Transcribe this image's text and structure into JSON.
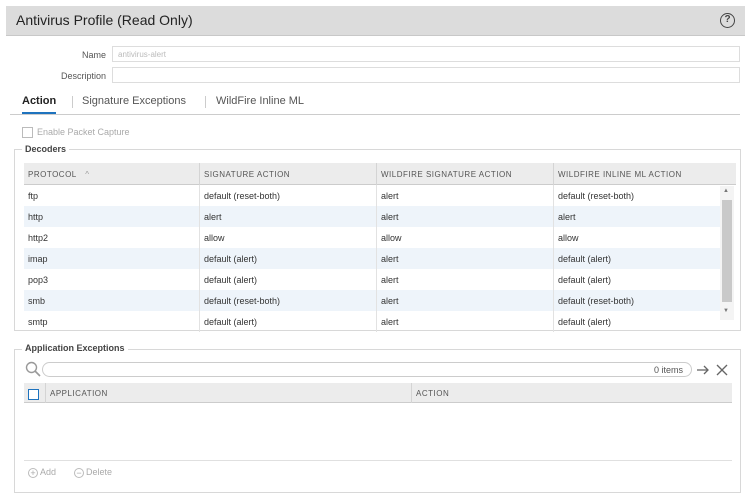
{
  "dialog": {
    "title": "Antivirus Profile (Read Only)",
    "help_symbol": "?"
  },
  "form": {
    "name_label": "Name",
    "name_value": "antivirus-alert",
    "description_label": "Description",
    "description_value": ""
  },
  "tabs": [
    {
      "label": "Action",
      "active": true
    },
    {
      "label": "Signature Exceptions",
      "active": false
    },
    {
      "label": "WildFire Inline ML",
      "active": false
    }
  ],
  "packet_capture": {
    "label": "Enable Packet Capture",
    "checked": false
  },
  "decoders": {
    "title": "Decoders",
    "columns": [
      "PROTOCOL",
      "SIGNATURE ACTION",
      "WILDFIRE SIGNATURE ACTION",
      "WILDFIRE INLINE ML ACTION"
    ],
    "sort_indicator": "^",
    "rows": [
      [
        "ftp",
        "default (reset-both)",
        "alert",
        "default (reset-both)"
      ],
      [
        "http",
        "alert",
        "alert",
        "alert"
      ],
      [
        "http2",
        "allow",
        "allow",
        "allow"
      ],
      [
        "imap",
        "default (alert)",
        "alert",
        "default (alert)"
      ],
      [
        "pop3",
        "default (alert)",
        "alert",
        "default (alert)"
      ],
      [
        "smb",
        "default (reset-both)",
        "alert",
        "default (reset-both)"
      ],
      [
        "smtp",
        "default (alert)",
        "alert",
        "default (alert)"
      ]
    ]
  },
  "app_exceptions": {
    "title": "Application Exceptions",
    "items_count": "0 items",
    "columns": [
      "APPLICATION",
      "ACTION"
    ],
    "add_label": "Add",
    "delete_label": "Delete"
  },
  "icons": {
    "search": "magnifier-icon",
    "go": "arrow-right-icon",
    "clear": "x-close-icon",
    "add": "plus-circle-icon",
    "delete": "minus-circle-icon"
  },
  "colors": {
    "tab_accent": "#1e73be",
    "row_alt": "#eef4fa",
    "header_bg": "#ececec",
    "titlebar_bg": "#dcdcdc"
  }
}
